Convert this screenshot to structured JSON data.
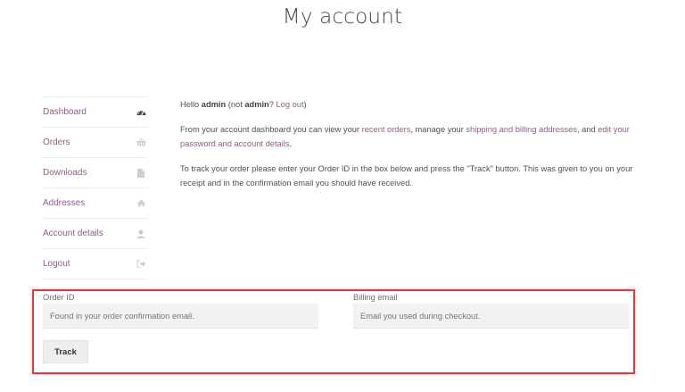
{
  "page": {
    "title": "My account"
  },
  "nav": {
    "items": [
      {
        "label": "Dashboard",
        "icon": "dashboard-gauge-icon"
      },
      {
        "label": "Orders",
        "icon": "basket-icon"
      },
      {
        "label": "Downloads",
        "icon": "file-icon"
      },
      {
        "label": "Addresses",
        "icon": "home-icon"
      },
      {
        "label": "Account details",
        "icon": "user-icon"
      },
      {
        "label": "Logout",
        "icon": "sign-out-icon"
      }
    ]
  },
  "dashboard": {
    "greeting_prefix": "Hello ",
    "user": "admin",
    "paren_open": " (not ",
    "user_again": "admin",
    "question": "? ",
    "logout_link": "Log out",
    "paren_close": ")",
    "intro_1": "From your account dashboard you can view your ",
    "recent_orders_link": "recent orders",
    "intro_2": ", manage your ",
    "addresses_link": "shipping and billing addresses",
    "intro_3": ", and ",
    "account_link": "edit your password and account details",
    "intro_4": ".",
    "track_instructions": "To track your order please enter your Order ID in the box below and press the \"Track\" button. This was given to you on your receipt and in the confirmation email you should have received."
  },
  "track_form": {
    "order_id_label": "Order ID",
    "order_id_placeholder": "Found in your order confirmation email.",
    "order_id_value": "",
    "email_label": "Billing email",
    "email_placeholder": "Email you used during checkout.",
    "email_value": "",
    "button_label": "Track"
  },
  "colors": {
    "link": "#96588a",
    "highlight_border": "#e0393e",
    "input_bg": "#f2f2f2"
  }
}
